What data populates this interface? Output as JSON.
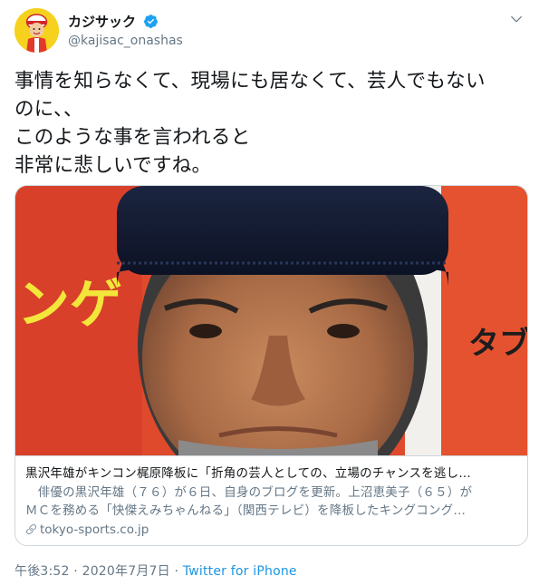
{
  "author": {
    "display_name": "カジサック",
    "handle": "@kajisac_onashas",
    "verified": true
  },
  "tweet": {
    "lines": [
      "事情を知らなくて、現場にも居なくて、芸人でもない",
      "のに、、",
      "このような事を言われると",
      "非常に悲しいですね。"
    ]
  },
  "card": {
    "title": "黒沢年雄がキンコン梶原降板に「折角の芸人としての、立場のチャンスを逃し…",
    "description_lines": [
      "　俳優の黒沢年雄（７６）が６日、自身のブログを更新。上沼恵美子（６５）が",
      "ＭＣを務める「快傑えみちゃんねる」（関西テレビ）を降板したキングコング…"
    ],
    "domain": "tokyo-sports.co.jp",
    "image_banner_text_left": "ンゲ",
    "image_banner_text_right": "タブ"
  },
  "meta": {
    "time": "午後3:52",
    "separator": " · ",
    "date": "2020年7月7日",
    "source": "Twitter for iPhone"
  },
  "colors": {
    "link": "#1b95e0",
    "secondary_text": "#657786",
    "verified_badge": "#1da1f2",
    "border": "#ccd6dd"
  },
  "icons": [
    "avatar",
    "verified-badge-icon",
    "chevron-down-icon",
    "link-icon"
  ]
}
